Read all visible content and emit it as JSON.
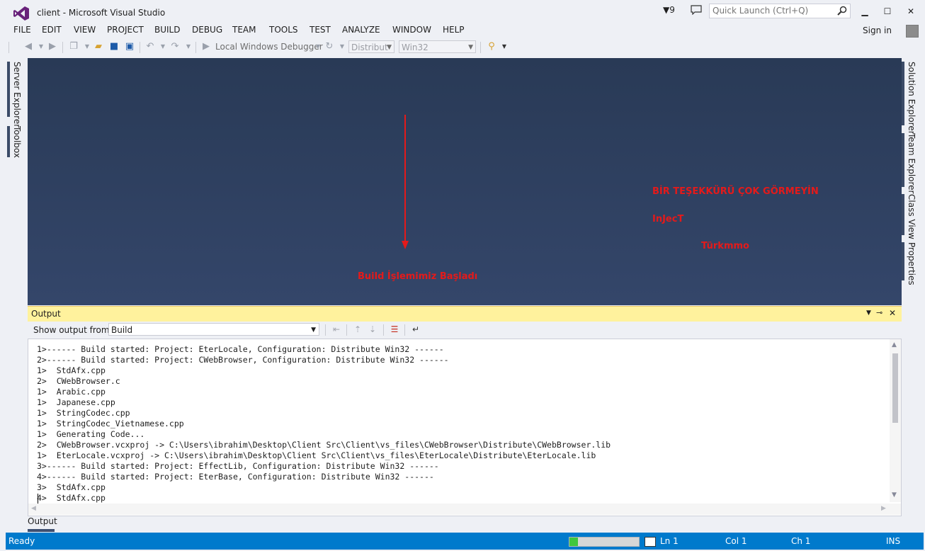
{
  "window": {
    "title": "client - Microsoft Visual Studio",
    "notification_count": "9",
    "quick_launch_placeholder": "Quick Launch (Ctrl+Q)",
    "minimize": "▁",
    "maximize": "☐",
    "close": "✕"
  },
  "menu": {
    "items": [
      "FILE",
      "EDIT",
      "VIEW",
      "PROJECT",
      "BUILD",
      "DEBUG",
      "TEAM",
      "TOOLS",
      "TEST",
      "ANALYZE",
      "WINDOW",
      "HELP"
    ],
    "sign_in": "Sign in"
  },
  "toolbar": {
    "debugger": "Local Windows Debugger",
    "config": "Distribut",
    "platform": "Win32"
  },
  "side_tabs": {
    "left": [
      "Server Explorer",
      "Toolbox"
    ],
    "right": [
      "Solution Explorer",
      "Team Explorer",
      "Class View",
      "Properties"
    ]
  },
  "annotations": {
    "build_started": "Build İşlemimiz Başladı",
    "thanks": "BİR TEŞEKKÜRÜ ÇOK GÖRMEYİN",
    "inject": "InJecT",
    "site": "Türkmmo"
  },
  "output": {
    "title": "Output",
    "show_from_label": "Show output from:",
    "show_from_value": "Build",
    "lines": [
      "1>------ Build started: Project: EterLocale, Configuration: Distribute Win32 ------",
      "2>------ Build started: Project: CWebBrowser, Configuration: Distribute Win32 ------",
      "1>  StdAfx.cpp",
      "2>  CWebBrowser.c",
      "1>  Arabic.cpp",
      "1>  Japanese.cpp",
      "1>  StringCodec.cpp",
      "1>  StringCodec_Vietnamese.cpp",
      "1>  Generating Code...",
      "2>  CWebBrowser.vcxproj -> C:\\Users\\ibrahim\\Desktop\\Client Src\\Client\\vs_files\\CWebBrowser\\Distribute\\CWebBrowser.lib",
      "1>  EterLocale.vcxproj -> C:\\Users\\ibrahim\\Desktop\\Client Src\\Client\\vs_files\\EterLocale\\Distribute\\EterLocale.lib",
      "3>------ Build started: Project: EffectLib, Configuration: Distribute Win32 ------",
      "4>------ Build started: Project: EterBase, Configuration: Distribute Win32 ------",
      "3>  StdAfx.cpp",
      "4>  StdAfx.cpp"
    ],
    "tab_label": "Output"
  },
  "status": {
    "ready": "Ready",
    "line": "Ln 1",
    "col": "Col 1",
    "ch": "Ch 1",
    "mode": "INS",
    "progress_fraction": 0.12
  },
  "colors": {
    "statusbar": "#007acc",
    "editor_bg": "#2c3d5b",
    "annotation_red": "#e41a1a",
    "output_header": "#fff29d",
    "vs_purple": "#68217a"
  }
}
